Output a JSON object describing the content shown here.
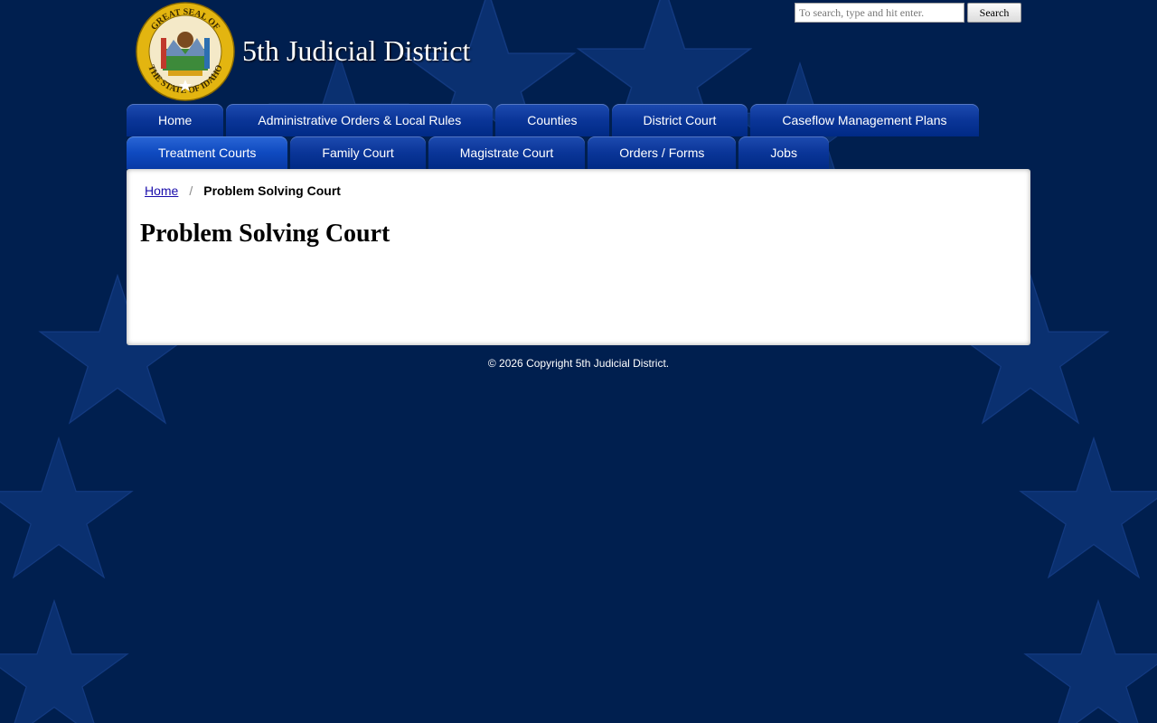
{
  "header": {
    "site_title": "5th Judicial District",
    "seal_outer_text": "GREAT SEAL OF THE STATE OF IDAHO"
  },
  "search": {
    "placeholder": "To search, type and hit enter.",
    "value": "",
    "button_label": "Search"
  },
  "nav": {
    "row1": [
      {
        "label": "Home"
      },
      {
        "label": "Administrative Orders & Local Rules"
      },
      {
        "label": "Counties"
      },
      {
        "label": "District Court"
      },
      {
        "label": "Caseflow Management Plans"
      }
    ],
    "row2": [
      {
        "label": "Treatment Courts"
      },
      {
        "label": "Family Court"
      },
      {
        "label": "Magistrate Court"
      },
      {
        "label": "Orders / Forms"
      },
      {
        "label": "Jobs"
      }
    ]
  },
  "breadcrumb": {
    "home": "Home",
    "separator": "/",
    "current": "Problem Solving Court"
  },
  "page": {
    "title": "Problem Solving Court"
  },
  "footer": {
    "copyright": "© 2026 Copyright 5th Judicial District."
  },
  "colors": {
    "background": "#001f4f",
    "star": "#0a3070",
    "tab": "#0a3598",
    "tab_active": "#0f4ac0",
    "link": "#1a0dab"
  }
}
